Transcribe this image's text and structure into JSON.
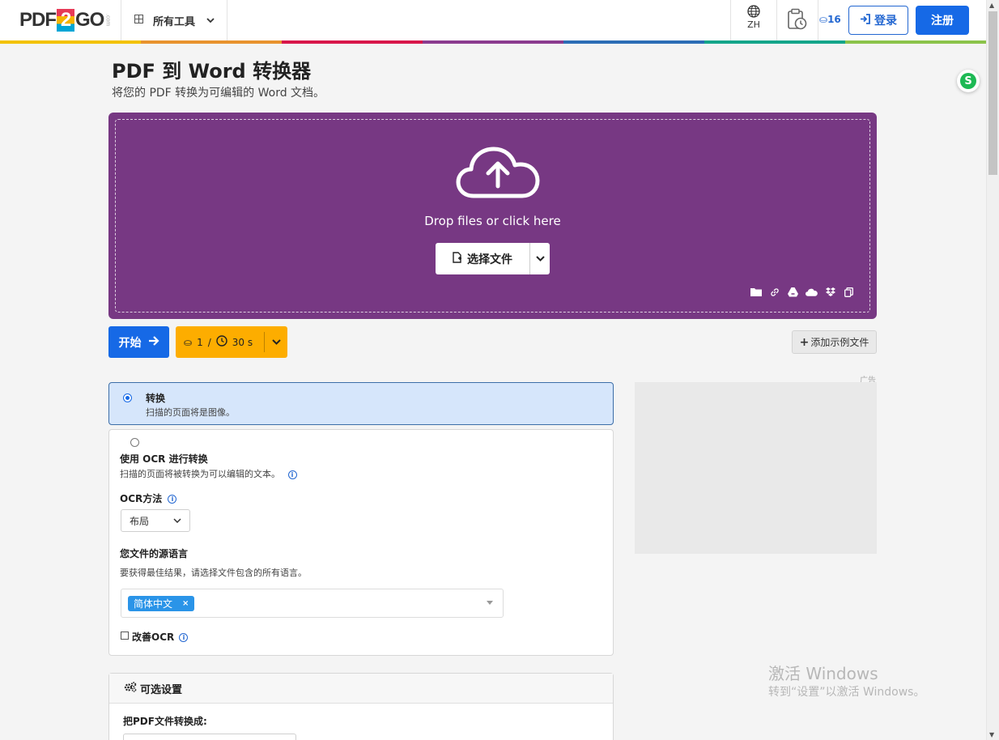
{
  "header": {
    "logo": {
      "left": "PDF",
      "mid": "2",
      "right": "GO",
      "suffix": ".com"
    },
    "all_tools": "所有工具",
    "language": "ZH",
    "credits": "16",
    "login": "登录",
    "register": "注册"
  },
  "stripe_colors": [
    "#f3c200",
    "#e8932e",
    "#d8174a",
    "#8b3b8f",
    "#2c6db5",
    "#14a58a",
    "#8bc34a"
  ],
  "page": {
    "title": "PDF 到 Word 转换器",
    "subtitle": "将您的 PDF 转换为可编辑的 Word 文档。"
  },
  "dropzone": {
    "text": "Drop files or click here",
    "choose_label": "选择文件",
    "bg": "#773883"
  },
  "actions": {
    "start": "开始",
    "credits_cost": "1",
    "slash": "/",
    "time": "30 s",
    "add_sample": "添加示例文件"
  },
  "options": {
    "convert": {
      "title": "转换",
      "desc": "扫描的页面将是图像。",
      "selected": true
    },
    "ocr": {
      "title": "使用 OCR 进行转换",
      "desc": "扫描的页面将被转换为可以编辑的文本。",
      "method_label": "OCR方法",
      "method_value": "布局",
      "source_lang_label": "您文件的源语言",
      "source_lang_desc": "要获得最佳结果，请选择文件包含的所有语言。",
      "selected_lang": "简体中文",
      "remove": "×",
      "improve": "改善OCR",
      "selected": false
    }
  },
  "ad": {
    "label": "广告"
  },
  "settings": {
    "title": "可选设置",
    "convert_to_label": "把PDF文件转换成:"
  },
  "watermark": {
    "line1": "激活 Windows",
    "line2": "转到“设置”以激活 Windows。"
  }
}
